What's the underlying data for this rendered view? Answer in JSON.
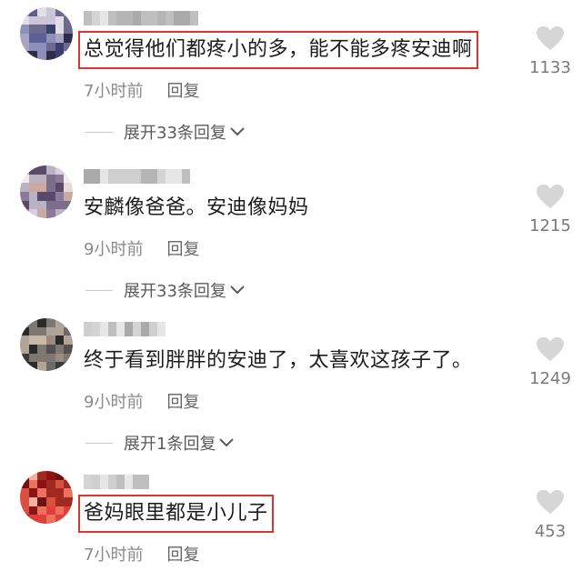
{
  "comments": [
    {
      "text": "总觉得他们都疼小的多，能不能多疼安迪啊",
      "time": "7小时前",
      "reply": "回复",
      "likes": "1133",
      "expand": "展开33条回复",
      "highlighted": true
    },
    {
      "text": "安麟像爸爸。安迪像妈妈",
      "time": "9小时前",
      "reply": "回复",
      "likes": "1215",
      "expand": "展开33条回复",
      "highlighted": false
    },
    {
      "text": "终于看到胖胖的安迪了，太喜欢这孩子了。",
      "time": "9小时前",
      "reply": "回复",
      "likes": "1249",
      "expand": "展开1条回复",
      "highlighted": false
    },
    {
      "text": "爸妈眼里都是小儿子",
      "time": "7小时前",
      "reply": "回复",
      "likes": "453",
      "highlighted": true
    }
  ],
  "colors": {
    "highlight_box": "#e0322e",
    "text": "#1c1c1c",
    "meta": "#8a8a8a",
    "like_icon": "#d6d6d6"
  }
}
